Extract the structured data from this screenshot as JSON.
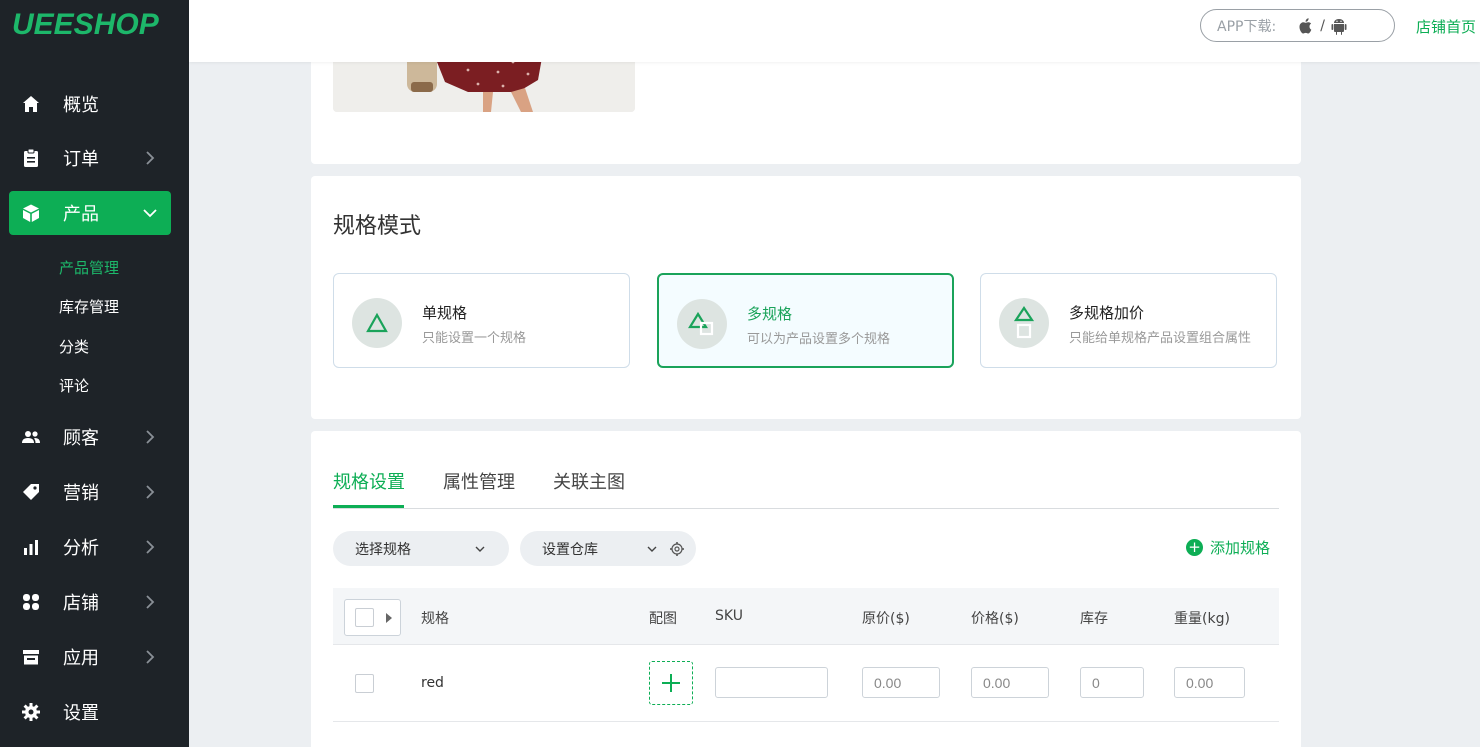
{
  "logo": "UEESHOP",
  "header": {
    "app_download_label": "APP下载:",
    "separator": "/",
    "shop_home": "店铺首页"
  },
  "sidebar": {
    "items": [
      {
        "label": "概览",
        "icon": "home-icon"
      },
      {
        "label": "订单",
        "icon": "clipboard-icon"
      },
      {
        "label": "产品",
        "icon": "box-icon",
        "active": true
      },
      {
        "label": "顾客",
        "icon": "users-icon"
      },
      {
        "label": "营销",
        "icon": "tag-icon"
      },
      {
        "label": "分析",
        "icon": "bar-chart-icon"
      },
      {
        "label": "店铺",
        "icon": "grid-icon"
      },
      {
        "label": "应用",
        "icon": "store-icon"
      },
      {
        "label": "设置",
        "icon": "gear-icon"
      }
    ],
    "sub_items": [
      {
        "label": "产品管理",
        "active": true
      },
      {
        "label": "库存管理"
      },
      {
        "label": "分类"
      },
      {
        "label": "评论"
      }
    ]
  },
  "spec_mode": {
    "title": "规格模式",
    "options": [
      {
        "title": "单规格",
        "desc": "只能设置一个规格"
      },
      {
        "title": "多规格",
        "desc": "可以为产品设置多个规格",
        "selected": true
      },
      {
        "title": "多规格加价",
        "desc": "只能给单规格产品设置组合属性"
      }
    ]
  },
  "spec_settings": {
    "tabs": [
      "规格设置",
      "属性管理",
      "关联主图"
    ],
    "select_spec": "选择规格",
    "set_warehouse": "设置仓库",
    "add_spec": "添加规格",
    "columns": [
      "规格",
      "配图",
      "SKU",
      "原价($)",
      "价格($)",
      "库存",
      "重量(kg)"
    ],
    "rows": [
      {
        "name": "red",
        "sku": "",
        "original_price": "0.00",
        "price": "0.00",
        "stock": "0",
        "weight": "0.00"
      }
    ]
  },
  "colors": {
    "accent": "#0dae55",
    "sidebar_bg": "#1e2328",
    "page_bg": "#eceff2"
  }
}
